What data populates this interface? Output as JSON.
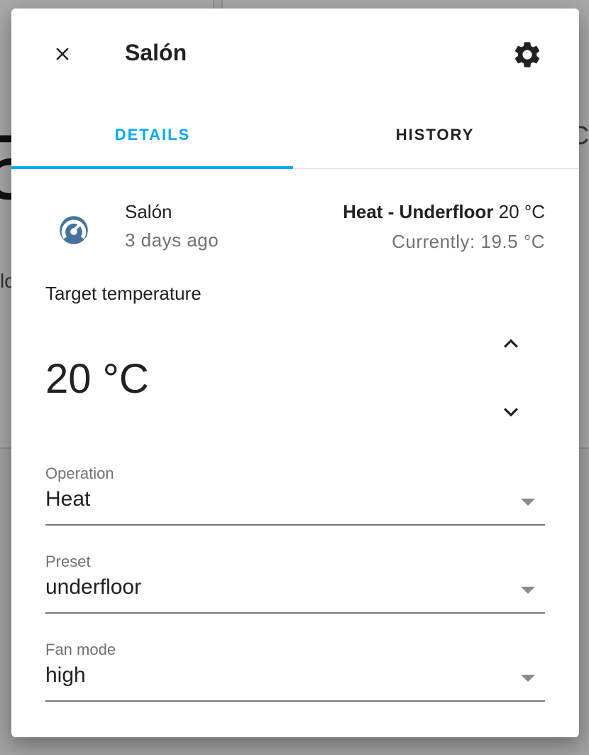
{
  "background": {
    "digit": "5",
    "char_left": "lo",
    "char_right": "C"
  },
  "dialog": {
    "title": "Salón",
    "close_icon": "close-icon",
    "settings_icon": "gear-icon"
  },
  "tabs": [
    {
      "label": "DETAILS",
      "active": true
    },
    {
      "label": "HISTORY",
      "active": false
    }
  ],
  "entity": {
    "name": "Salón",
    "last_changed": "3 days ago",
    "icon": "thermostat-icon",
    "state_mode": "Heat - Underfloor",
    "state_target": "20 °C",
    "current_label": "Currently: 19.5 °C"
  },
  "target": {
    "label": "Target temperature",
    "value": "20 °C",
    "up_icon": "chevron-up-icon",
    "down_icon": "chevron-down-icon"
  },
  "fields": {
    "operation": {
      "label": "Operation",
      "value": "Heat"
    },
    "preset": {
      "label": "Preset",
      "value": "underfloor"
    },
    "fan_mode": {
      "label": "Fan mode",
      "value": "high"
    }
  },
  "colors": {
    "accent": "#03a9f4",
    "icon": "#44739e",
    "text_primary": "#212121",
    "text_secondary": "#727272"
  }
}
